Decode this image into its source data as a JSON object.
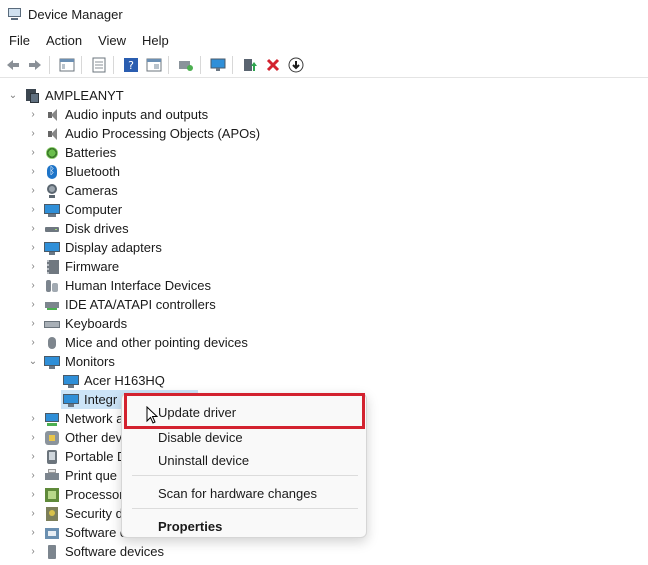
{
  "window": {
    "title": "Device Manager"
  },
  "menubar": {
    "items": [
      "File",
      "Action",
      "View",
      "Help"
    ]
  },
  "toolbar": {
    "buttons": [
      "back-icon",
      "forward-icon",
      "show-hide-tree-icon",
      "properties-icon",
      "help-icon",
      "view-icon",
      "scan-hardware-icon",
      "monitor-icon",
      "update-driver-icon",
      "uninstall-icon",
      "disable-icon"
    ]
  },
  "tree": {
    "root": "AMPLEANYT",
    "categories": [
      "Audio inputs and outputs",
      "Audio Processing Objects (APOs)",
      "Batteries",
      "Bluetooth",
      "Cameras",
      "Computer",
      "Disk drives",
      "Display adapters",
      "Firmware",
      "Human Interface Devices",
      "IDE ATA/ATAPI controllers",
      "Keyboards",
      "Mice and other pointing devices",
      "Monitors"
    ],
    "monitor_children": [
      "Acer H163HQ",
      "Integr"
    ],
    "after": [
      "Network a",
      "Other dev",
      "Portable D",
      "Print que",
      "Processor",
      "Security d",
      "Software c",
      "Software devices"
    ]
  },
  "context_menu": {
    "items": [
      "Update driver",
      "Disable device",
      "Uninstall device",
      "Scan for hardware changes",
      "Properties"
    ],
    "highlight_color": "#d3222f"
  },
  "colors": {
    "accent": "#2f8fd8",
    "selection": "#cce4f7",
    "highlight_box": "#d3222f"
  }
}
